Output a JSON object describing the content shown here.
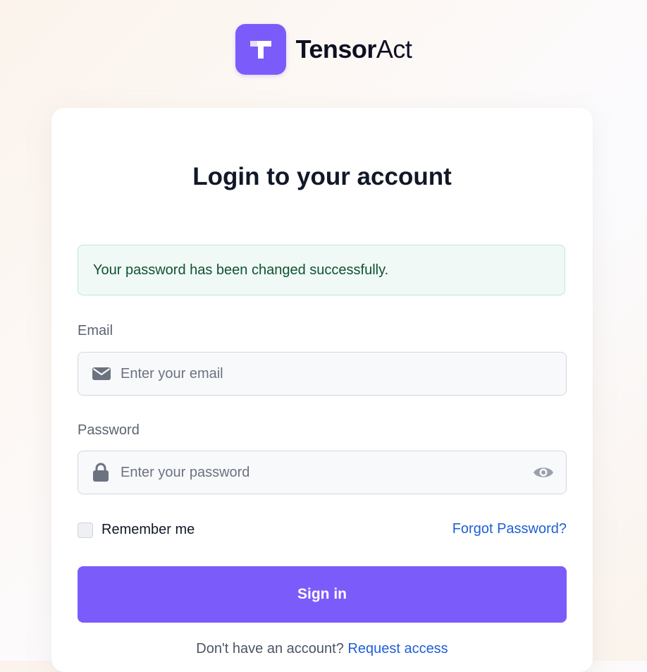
{
  "brand": {
    "name_strong": "Tensor",
    "name_light": "Act",
    "logo_color": "#7B5CFA"
  },
  "login": {
    "title": "Login to your account",
    "alert": {
      "message": "Your password has been changed successfully.",
      "status": "success"
    },
    "email": {
      "label": "Email",
      "placeholder": "Enter your email",
      "value": "",
      "icon": "envelope-icon"
    },
    "password": {
      "label": "Password",
      "placeholder": "Enter your password",
      "value": "",
      "icon": "lock-icon",
      "toggle_icon": "eye-icon"
    },
    "remember": {
      "label": "Remember me",
      "checked": false
    },
    "forgot_password": "Forgot Password?",
    "submit_label": "Sign in",
    "footer": {
      "prompt": "Don't have an account?",
      "link": "Request access"
    }
  },
  "colors": {
    "accent": "#7B5CFA",
    "link": "#1f5fd6",
    "success_text": "#0f5234",
    "success_bg": "#f0f9f5"
  }
}
